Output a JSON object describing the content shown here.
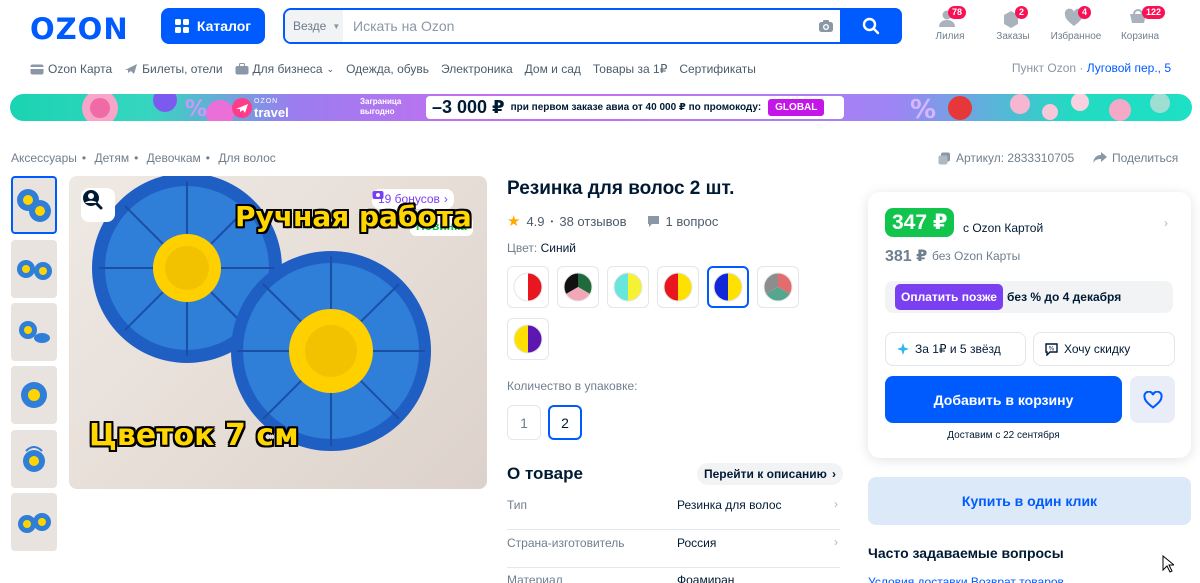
{
  "header": {
    "logo": "OZON",
    "catalog_label": "Каталог",
    "search": {
      "scope": "Везде",
      "placeholder": "Искать на Ozon"
    },
    "icons": [
      {
        "name": "user-icon",
        "label": "Лилия",
        "badge": "78"
      },
      {
        "name": "orders-icon",
        "label": "Заказы",
        "badge": "2"
      },
      {
        "name": "heart-icon",
        "label": "Избранное",
        "badge": "4"
      },
      {
        "name": "cart-icon",
        "label": "Корзина",
        "badge": "122"
      }
    ]
  },
  "nav": {
    "items": [
      "Ozon Карта",
      "Билеты, отели",
      "Для бизнеса",
      "Одежда, обувь",
      "Электроника",
      "Дом и сад",
      "Товары за 1₽",
      "Сертификаты"
    ],
    "pickup_label": "Пункт Ozon ·",
    "pickup_address": "Луговой пер., 5"
  },
  "banner": {
    "brand_top": "OZON",
    "brand": "travel",
    "slogan": "Заграница выгодно",
    "amount": "–3 000 ₽",
    "promo": "при первом заказе авиа от 40 000 ₽ по промокоду:",
    "code": "GLOBAL",
    "colors": {
      "accent": "#c416e8"
    }
  },
  "breadcrumbs": [
    "Аксессуары",
    "Детям",
    "Девочкам",
    "Для волос"
  ],
  "article": "Артикул: 2833310705",
  "share": "Поделиться",
  "gallery": {
    "bonus": "19 бонусов",
    "new_tag": "Новинка",
    "overlay_top": "Ручная работа",
    "overlay_bottom": "Цветок 7 см"
  },
  "product": {
    "title": "Резинка для волос 2 шт.",
    "rating": "4.9",
    "reviews": "38 отзывов",
    "questions": "1 вопрос",
    "color_label": "Цвет:",
    "color_value": "Синий",
    "swatches": [
      {
        "a": "#e8171f",
        "b": "#ffffff"
      },
      {
        "a": "#1f6b3b",
        "b": "#f2a7b6",
        "c": "#111111"
      },
      {
        "a": "#f4f233",
        "b": "#69e6dc"
      },
      {
        "a": "#ffe100",
        "b": "#e8171f"
      },
      {
        "a": "#ffe100",
        "b": "#1228d8"
      },
      {
        "a": "#e36c6c",
        "b": "#56a58d",
        "c": "#8d8d8d"
      },
      {
        "a": "#5d16b0",
        "b": "#ffe100"
      }
    ],
    "selected_swatch": 4,
    "qty_label": "Количество в упаковке:",
    "qty_options": [
      "1",
      "2"
    ],
    "qty_selected": "2",
    "about": "О товаре",
    "to_description": "Перейти к описанию",
    "specs": [
      {
        "k": "Тип",
        "v": "Резинка для волос"
      },
      {
        "k": "Страна-изготовитель",
        "v": "Россия"
      },
      {
        "k": "Материал",
        "v": "Фоамиран"
      }
    ]
  },
  "buy": {
    "price_card": "347 ₽",
    "price_card_label": "с Ozon Картой",
    "price": "381 ₽",
    "price_label": "без Ozon Карты",
    "pay_later": "Оплатить позже",
    "pay_later_text": "без % до 4 декабря",
    "stars_offer": "За 1₽ и 5 звёзд",
    "want_discount": "Хочу скидку",
    "add_to_cart": "Добавить в корзину",
    "delivery": "Доставим с 22 сентября",
    "one_click": "Купить в один клик",
    "faq_title": "Часто задаваемые вопросы",
    "faq_links": "Условия доставки   Возврат товаров"
  },
  "colors": {
    "brand": "#005bff",
    "price": "#10c44c",
    "purple": "#7b3ff2"
  }
}
